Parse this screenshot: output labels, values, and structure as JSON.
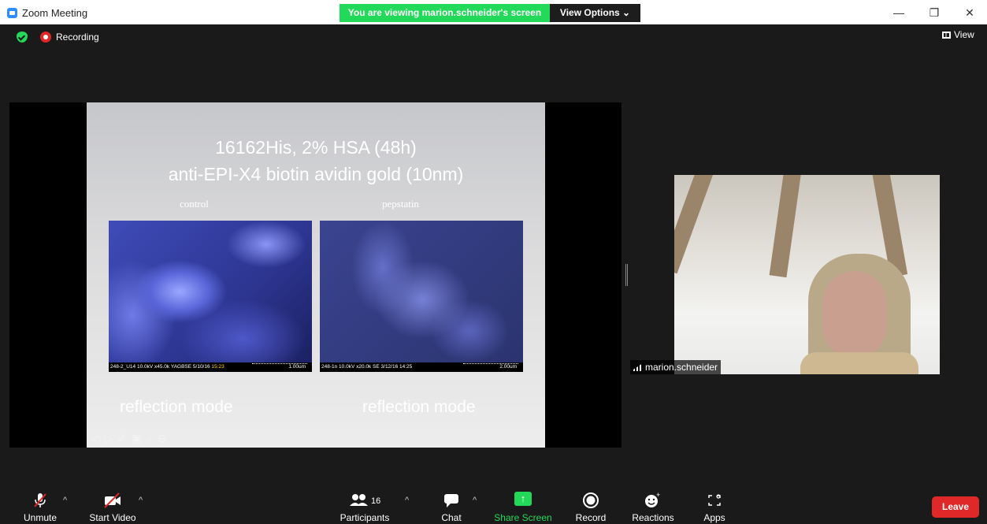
{
  "titlebar": {
    "title": "Zoom Meeting",
    "viewing_banner": "You are viewing marion.schneider's screen",
    "view_options": "View Options ⌄",
    "minimize": "—",
    "restore": "❐",
    "close": "✕"
  },
  "status": {
    "recording": "Recording",
    "view": "View"
  },
  "slide": {
    "title_line1": "16162His, 2% HSA (48h)",
    "title_line2": "anti-EPI-X4 biotin avidin gold (10nm)",
    "caption_left": "control",
    "caption_right": "pepstatin",
    "image_left_meta": "248-2_U14 10.0kV x45.0k YAGBSE 5/10/16",
    "image_left_time": "15:23",
    "image_left_scale": "1.00um",
    "image_right_meta": "248-1n 10.0kV x20.0k SE 3/12/16 14:25",
    "image_right_time": "14:25",
    "image_right_scale": "2.00um",
    "footer_left": "reflection mode",
    "footer_right": "reflection mode",
    "nav_controls": "◁ ▷ ✐ ▣ ⌕ ⊖"
  },
  "participant": {
    "name": "marion.schneider"
  },
  "toolbar": {
    "unmute": "Unmute",
    "start_video": "Start Video",
    "participants": "Participants",
    "participants_count": "16",
    "chat": "Chat",
    "share_screen": "Share Screen",
    "record": "Record",
    "reactions": "Reactions",
    "apps": "Apps",
    "leave": "Leave",
    "caret": "^"
  },
  "colors": {
    "accent_green": "#23d959",
    "leave_red": "#e02828",
    "background": "#1a1a1a"
  }
}
